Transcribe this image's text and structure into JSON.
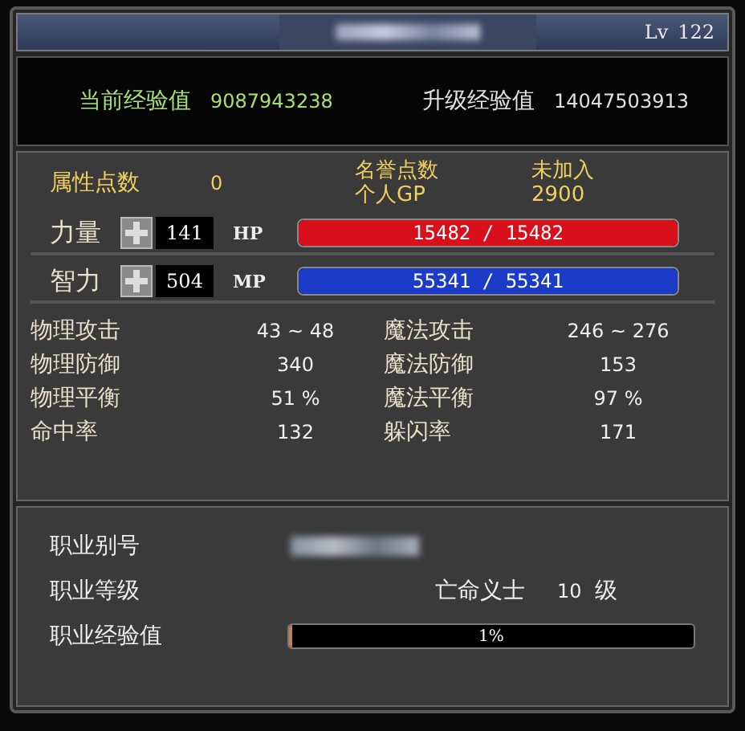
{
  "title_bar": {
    "level_label": "Lv",
    "level": "122"
  },
  "experience": {
    "current_label": "当前经验值",
    "current": "9087943238",
    "next_label": "升级经验值",
    "next": "14047503913"
  },
  "points": {
    "attr_label": "属性点数",
    "attr_value": "0",
    "fame_label": "名誉点数",
    "fame_value": "未加入",
    "gp_label": "个人GP",
    "gp_value": "2900"
  },
  "attributes": [
    {
      "label": "力量",
      "value": "141",
      "bar_label": "HP",
      "bar_text": "15482 / 15482",
      "level": 1,
      "color": "#d8101c"
    },
    {
      "label": "智力",
      "value": "504",
      "bar_label": "MP",
      "bar_text": "55341 / 55341",
      "level": 1,
      "color": "#1c3cc8"
    }
  ],
  "stats": [
    {
      "left": {
        "label": "物理攻击",
        "value": "43 ~ 48"
      },
      "right": {
        "label": "魔法攻击",
        "value": "246 ~ 276"
      }
    },
    {
      "left": {
        "label": "物理防御",
        "value": "340"
      },
      "right": {
        "label": "魔法防御",
        "value": "153"
      }
    },
    {
      "left": {
        "label": "物理平衡",
        "value": "51 %"
      },
      "right": {
        "label": "魔法平衡",
        "value": "97 %"
      }
    },
    {
      "left": {
        "label": "命中率",
        "value": "132"
      },
      "right": {
        "label": "躲闪率",
        "value": "171"
      }
    }
  ],
  "job": {
    "alias_label": "职业别号",
    "rank_label": "职业等级",
    "class_name": "亡命义士",
    "rank": "10",
    "rank_unit": "级",
    "exp_label": "职业经验值",
    "exp_text": "1%",
    "level": 0.01
  }
}
